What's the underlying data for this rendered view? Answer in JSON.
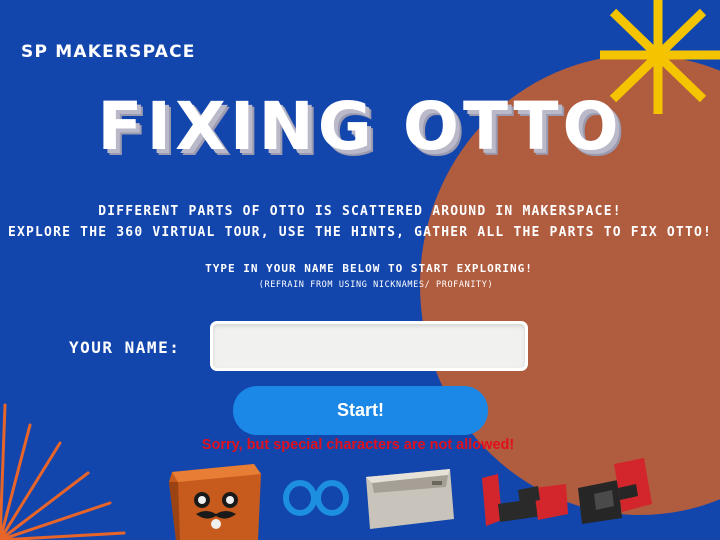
{
  "brand": "SP MAKERSPACE",
  "title": "FIXING OTTO",
  "intro": {
    "line1": "DIFFERENT PARTS OF OTTO IS SCATTERED AROUND IN MAKERSPACE!",
    "line2": "EXPLORE THE 360 VIRTUAL TOUR, USE THE HINTS, GATHER ALL THE PARTS TO FIX OTTO!"
  },
  "prompt": {
    "main": "TYPE IN YOUR NAME BELOW TO START EXPLORING!",
    "note": "(REFRAIN FROM USING NICKNAMES/ PROFANITY)"
  },
  "form": {
    "name_label": "YOUR NAME:",
    "name_value": "",
    "start_label": "Start!",
    "error": "Sorry, but special characters are not allowed!"
  },
  "colors": {
    "background": "#1346ad",
    "circle": "#b05c3e",
    "accent_star": "#f4c400",
    "rays": "#e8652a",
    "button": "#1b87e6",
    "error": "#e2101c"
  },
  "parts": [
    "otto-head-part",
    "blue-rings-part",
    "grey-body-part",
    "red-leg-part",
    "black-foot-part"
  ]
}
